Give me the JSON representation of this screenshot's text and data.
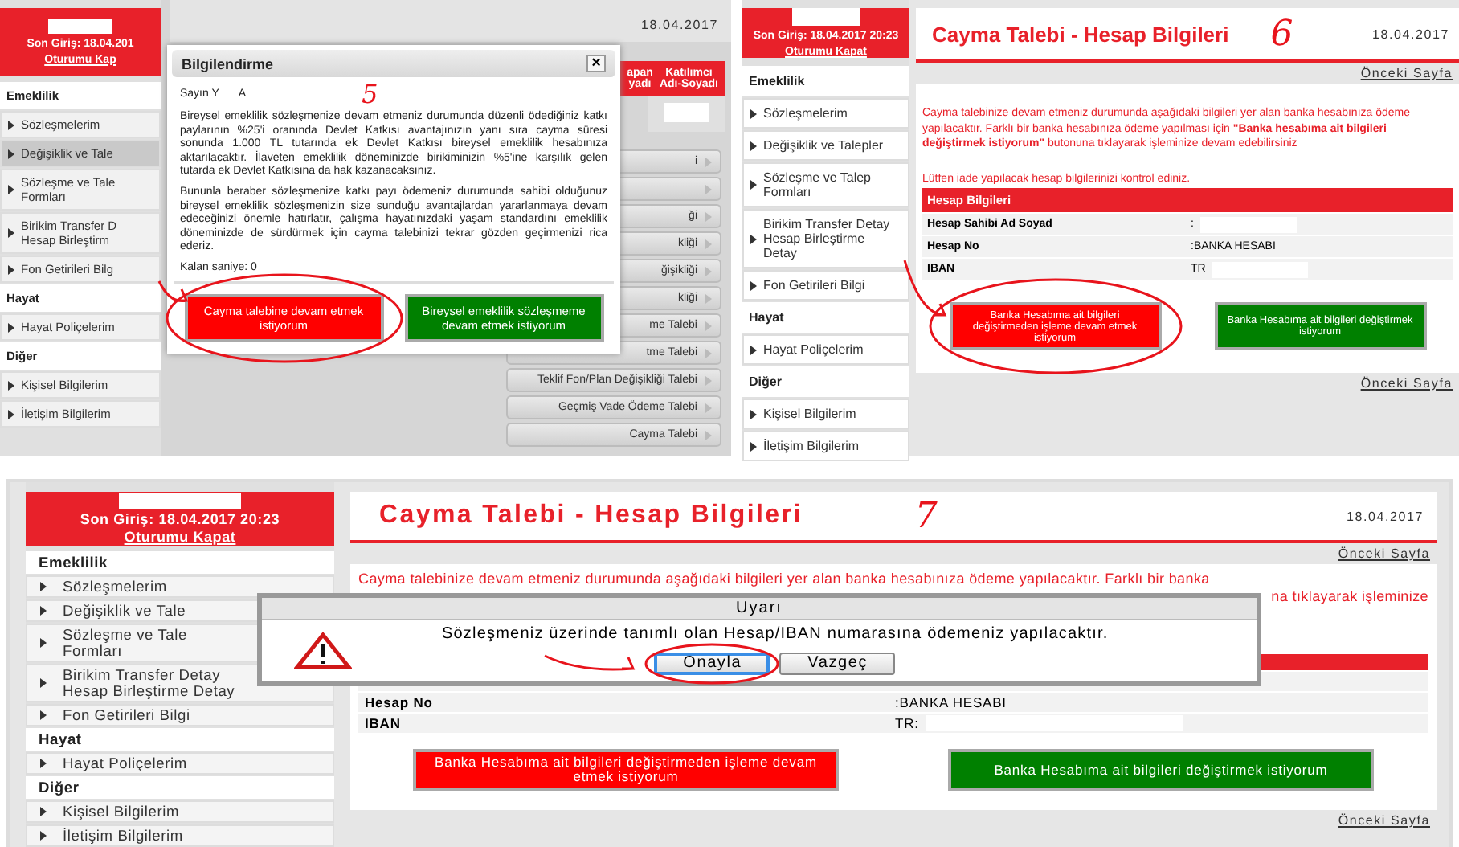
{
  "screen_5": {
    "annotation": "5",
    "sidebar": {
      "last_login": "Son Giriş: 18.04.201",
      "logout": "Oturumu Kap",
      "sections": [
        {
          "title": "Emeklilik",
          "items": [
            {
              "label": "Sözleşmelerim",
              "selected": false
            },
            {
              "label": "Değişiklik ve Tale",
              "selected": true
            },
            {
              "label": "Sözleşme ve Tale\nFormları",
              "selected": false
            },
            {
              "label": "Birikim Transfer D\nHesap Birleştirm",
              "selected": false
            },
            {
              "label": "Fon Getirileri Bilg",
              "selected": false
            }
          ]
        },
        {
          "title": "Hayat",
          "items": [
            {
              "label": "Hayat Poliçelerim",
              "selected": false
            }
          ]
        },
        {
          "title": "Diğer",
          "items": [
            {
              "label": "Kişisel Bilgilerim",
              "selected": false
            },
            {
              "label": "İletişim Bilgilerim",
              "selected": false
            }
          ]
        }
      ]
    },
    "date": "18.04.2017",
    "table_columns": [
      "apan\nyadı",
      "Katılımcı\nAdı-Soyadı"
    ],
    "actions": [
      {
        "kind": "labelled",
        "label": "i"
      },
      {
        "kind": "blank"
      },
      {
        "kind": "labelled",
        "label": "ği"
      },
      {
        "kind": "labelled",
        "label": "kliği"
      },
      {
        "kind": "labelled",
        "label": "ğişikliği"
      },
      {
        "kind": "labelled",
        "label": "kliği"
      },
      {
        "kind": "labelled",
        "label": "me Talebi"
      },
      {
        "kind": "labelled",
        "label": "tme Talebi"
      },
      {
        "kind": "labelled",
        "label": "Teklif Fon/Plan Değişikliği Talebi"
      },
      {
        "kind": "labelled",
        "label": "Geçmiş Vade Ödeme Talebi"
      },
      {
        "kind": "labelled",
        "label": "Cayma Talebi"
      }
    ],
    "dialog": {
      "title": "Bilgilendirme",
      "close": "×",
      "greeting": [
        "Sayın Y",
        "A"
      ],
      "paragraphs": [
        "Bireysel emeklilik sözleşmenize devam etmeniz durumunda düzenli ödediğiniz katkı paylarının %25'i oranında Devlet Katkısı avantajınızın yanı sıra cayma süresi sonunda 1.000 TL tutarında ek Devlet Katkısı bireysel emeklilik hesabınıza aktarılacaktır. İlaveten emeklilik döneminizde birikiminizin %5'ine karşılık gelen tutarda ek Devlet Katkısına da hak kazanacaksınız.",
        "Bununla beraber sözleşmenize katkı payı ödemeniz durumunda sahibi olduğunuz bireysel emeklilik sözleşmenizin size sunduğu avantajlardan yararlanmaya devam edeceğinizi önemle hatırlatır, çalışma hayatınızdaki yaşam standardını emeklilik döneminizde de sürdürmek için cayma talebinizi tekrar gözden geçirmenizi rica ederiz."
      ],
      "countdown": "Kalan saniye: 0",
      "buttons": [
        {
          "label": "Cayma talebine devam etmek istiyorum",
          "kind": "danger"
        },
        {
          "label": "Bireysel emeklilik sözleşmeme devam etmek istiyorum",
          "kind": "confirm"
        }
      ]
    }
  },
  "screen_6": {
    "annotation": "6",
    "sidebar": {
      "last_login": "Son Giriş: 18.04.2017 20:23",
      "logout": "Oturumu Kapat",
      "sections": [
        {
          "title": "Emeklilik",
          "items": [
            {
              "label": "Sözleşmelerim",
              "selected": false
            },
            {
              "label": "Değişiklik ve Talepler",
              "selected": false
            },
            {
              "label": "Sözleşme ve Talep\nFormları",
              "selected": false
            },
            {
              "label": "Birikim Transfer Detay\nHesap Birleştirme Detay",
              "selected": false
            },
            {
              "label": "Fon Getirileri Bilgi",
              "selected": false
            }
          ]
        },
        {
          "title": "Hayat",
          "items": [
            {
              "label": "Hayat Poliçelerim",
              "selected": false
            }
          ]
        },
        {
          "title": "Diğer",
          "items": [
            {
              "label": "Kişisel Bilgilerim",
              "selected": false
            },
            {
              "label": "İletişim Bilgilerim",
              "selected": false
            }
          ]
        }
      ]
    },
    "title": "Cayma Talebi - Hesap Bilgileri",
    "date": "18.04.2017",
    "back_links": [
      "Önceki Sayfa",
      "Önceki Sayfa"
    ],
    "info": "Cayma talebinize devam etmeniz durumunda aşağıdaki bilgileri yer alan banka hesabınıza ödeme yapılacaktır. Farklı bir banka hesabınıza ödeme yapılması için **\"Banka hesabıma ait bilgileri değiştirmek istiyorum\"** butonuna tıklayarak işleminize devam edebilirsiniz",
    "notice": "Lütfen iade yapılacak hesap bilgilerinizi kontrol ediniz.",
    "account": {
      "title": "Hesap Bilgileri",
      "rows": [
        {
          "label": "Hesap Sahibi Ad Soyad",
          "value": ":",
          "masked": true
        },
        {
          "label": "Hesap No",
          "value": ":BANKA HESABI",
          "masked": false
        },
        {
          "label": "IBAN",
          "value": "TR",
          "masked": true
        }
      ]
    },
    "buttons": [
      {
        "label": "Banka Hesabıma ait bilgileri değiştirmeden işleme devam etmek istiyorum",
        "kind": "danger"
      },
      {
        "label": "Banka Hesabıma ait bilgileri değiştirmek istiyorum",
        "kind": "confirm"
      }
    ]
  },
  "screen_7": {
    "annotation": "7",
    "sidebar": {
      "last_login": "Son Giriş: 18.04.2017 20:23",
      "logout": "Oturumu Kapat",
      "sections": [
        {
          "title": "Emeklilik",
          "items": [
            {
              "label": "Sözleşmelerim",
              "selected": false
            },
            {
              "label": "Değişiklik ve Tale",
              "selected": false
            },
            {
              "label": "Sözleşme ve Tale\nFormları",
              "selected": false
            },
            {
              "label": "Birikim Transfer Detay\nHesap Birleştirme Detay",
              "selected": false
            },
            {
              "label": "Fon Getirileri Bilgi",
              "selected": false
            }
          ]
        },
        {
          "title": "Hayat",
          "items": [
            {
              "label": "Hayat Poliçelerim",
              "selected": false
            }
          ]
        },
        {
          "title": "Diğer",
          "items": [
            {
              "label": "Kişisel Bilgilerim",
              "selected": false
            },
            {
              "label": "İletişim Bilgilerim",
              "selected": false
            }
          ]
        }
      ]
    },
    "title": "Cayma Talebi - Hesap Bilgileri",
    "date": "18.04.2017",
    "back_links": [
      "Önceki Sayfa",
      "Önceki Sayfa"
    ],
    "info_line": "Cayma talebinize devam etmeniz durumunda aşağıdaki bilgileri yer alan banka hesabınıza ödeme yapılacaktır. Farklı bir banka",
    "info_fragment": "na tıklayarak işleminize",
    "account": {
      "rows": [
        {
          "label": "Hesap No",
          "value": ":BANKA HESABI",
          "masked": false
        },
        {
          "label": "IBAN",
          "value": "TR:",
          "masked": true
        }
      ]
    },
    "buttons": [
      {
        "label": "Banka Hesabıma ait bilgileri değiştirmeden işleme devam etmek istiyorum",
        "kind": "danger"
      },
      {
        "label": "Banka Hesabıma ait bilgileri değiştirmek istiyorum",
        "kind": "confirm"
      }
    ],
    "dialog": {
      "title": "Uyarı",
      "message": "Sözleşmeniz üzerinde tanımlı olan Hesap/IBAN numarasına ödemeniz yapılacaktır.",
      "buttons": [
        {
          "label": "Onayla",
          "selected": true
        },
        {
          "label": "Vazgeç",
          "selected": false
        }
      ]
    }
  }
}
